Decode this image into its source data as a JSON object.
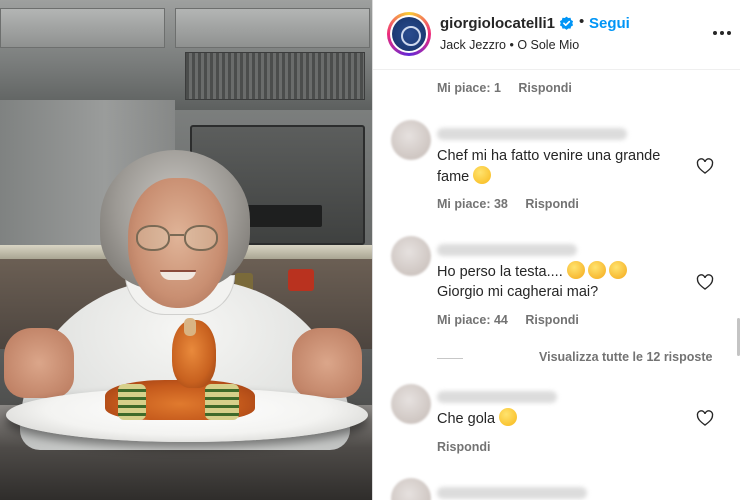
{
  "post": {
    "username": "giorgiolocatelli1",
    "follow_label": "Segui",
    "separator": "•",
    "audio": "Jack Jezzro • O Sole Mio"
  },
  "comments": [
    {
      "text": "",
      "likes_label": "Mi piace: 1",
      "reply_label": "Rispondi"
    },
    {
      "text": "Chef mi ha fatto venire una grande fame",
      "emoji": "grinning-sweat-emoji",
      "likes_label": "Mi piace: 38",
      "reply_label": "Rispondi"
    },
    {
      "text_line1": "Ho perso la testa....",
      "text_line2": "Giorgio mi cagherai mai?",
      "emoji": "star-struck-emoji",
      "likes_label": "Mi piace: 44",
      "reply_label": "Rispondi"
    },
    {
      "text": "Che gola",
      "emoji": "yum-emoji",
      "reply_label": "Rispondi"
    }
  ],
  "view_replies_label": "Visualizza tutte le 12 risposte",
  "colors": {
    "accent_link": "#0095f6",
    "text_primary": "#262626",
    "text_secondary": "#737373"
  }
}
